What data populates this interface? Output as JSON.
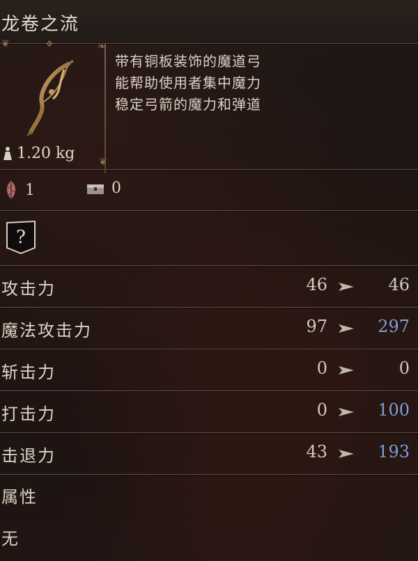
{
  "item": {
    "name": "龙卷之流",
    "description": [
      "带有铜板装饰的魔道弓",
      "能帮助使用者集中魔力",
      "稳定弓箭的魔力和弹道"
    ],
    "weight": "1.20 kg",
    "icon": "bow-icon"
  },
  "counts": {
    "first": {
      "icon": "feather-icon",
      "value": "1"
    },
    "second": {
      "icon": "chest-icon",
      "value": "0"
    }
  },
  "unknown_slot": {
    "icon": "question-mark-icon",
    "label": "?"
  },
  "stats": [
    {
      "label": "攻击力",
      "old": "46",
      "new": "46",
      "boosted": false
    },
    {
      "label": "魔法攻击力",
      "old": "97",
      "new": "297",
      "boosted": true
    },
    {
      "label": "斩击力",
      "old": "0",
      "new": "0",
      "boosted": false
    },
    {
      "label": "打击力",
      "old": "0",
      "new": "100",
      "boosted": true
    },
    {
      "label": "击退力",
      "old": "43",
      "new": "193",
      "boosted": true
    }
  ],
  "attribute": {
    "heading": "属性",
    "value": "无"
  },
  "colors": {
    "boosted": "#7f9fd4",
    "text": "#d8d2c4",
    "divider": "#5e5248"
  }
}
